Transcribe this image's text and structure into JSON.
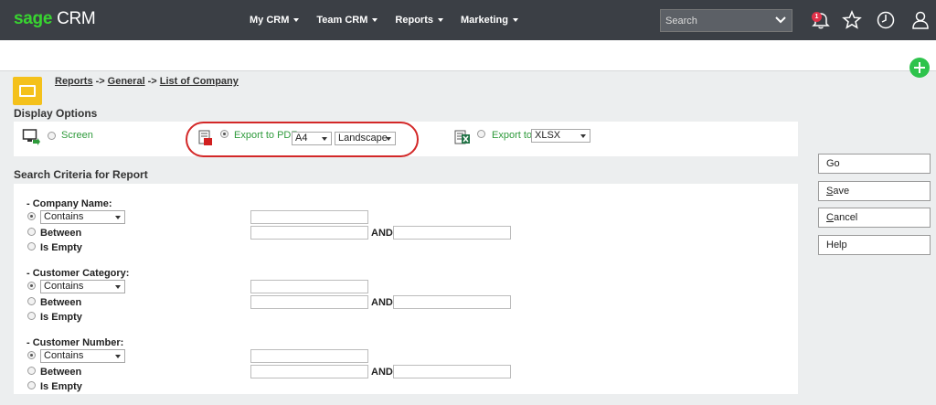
{
  "app": {
    "logo_brand": "sage",
    "logo_product": "CRM"
  },
  "nav": {
    "items": [
      "My CRM",
      "Team CRM",
      "Reports",
      "Marketing"
    ]
  },
  "search": {
    "placeholder": "Search"
  },
  "notifications": {
    "count": "1"
  },
  "breadcrumb": [
    "Reports",
    "General",
    "List of Company"
  ],
  "breadcrumb_sep": "->",
  "display_options": {
    "title": "Display Options",
    "screen_label": "Screen",
    "pdf_label": "Export to PDF",
    "pdf_size": "A4",
    "pdf_orientation": "Landscape",
    "export_label": "Export to",
    "export_format": "XLSX",
    "selected": "pdf"
  },
  "criteria": {
    "title": "Search Criteria for Report",
    "and_label": "AND",
    "groups": [
      {
        "label": "- Company Name:",
        "operator": "Contains",
        "between": "Between",
        "empty": "Is Empty"
      },
      {
        "label": "- Customer Category:",
        "operator": "Contains",
        "between": "Between",
        "empty": "Is Empty"
      },
      {
        "label": "- Customer Number:",
        "operator": "Contains",
        "between": "Between",
        "empty": "Is Empty"
      }
    ]
  },
  "actions": {
    "go": {
      "first": "",
      "rest": "Go"
    },
    "save": {
      "first": "S",
      "rest": "ave"
    },
    "cancel": {
      "first": "C",
      "rest": "ancel"
    },
    "help": {
      "first": "",
      "rest": "Help"
    }
  },
  "colors": {
    "topbar": "#3b3f45",
    "brand_green": "#38d430",
    "accent_green": "#2e9a3b",
    "highlight_red": "#d32828"
  }
}
